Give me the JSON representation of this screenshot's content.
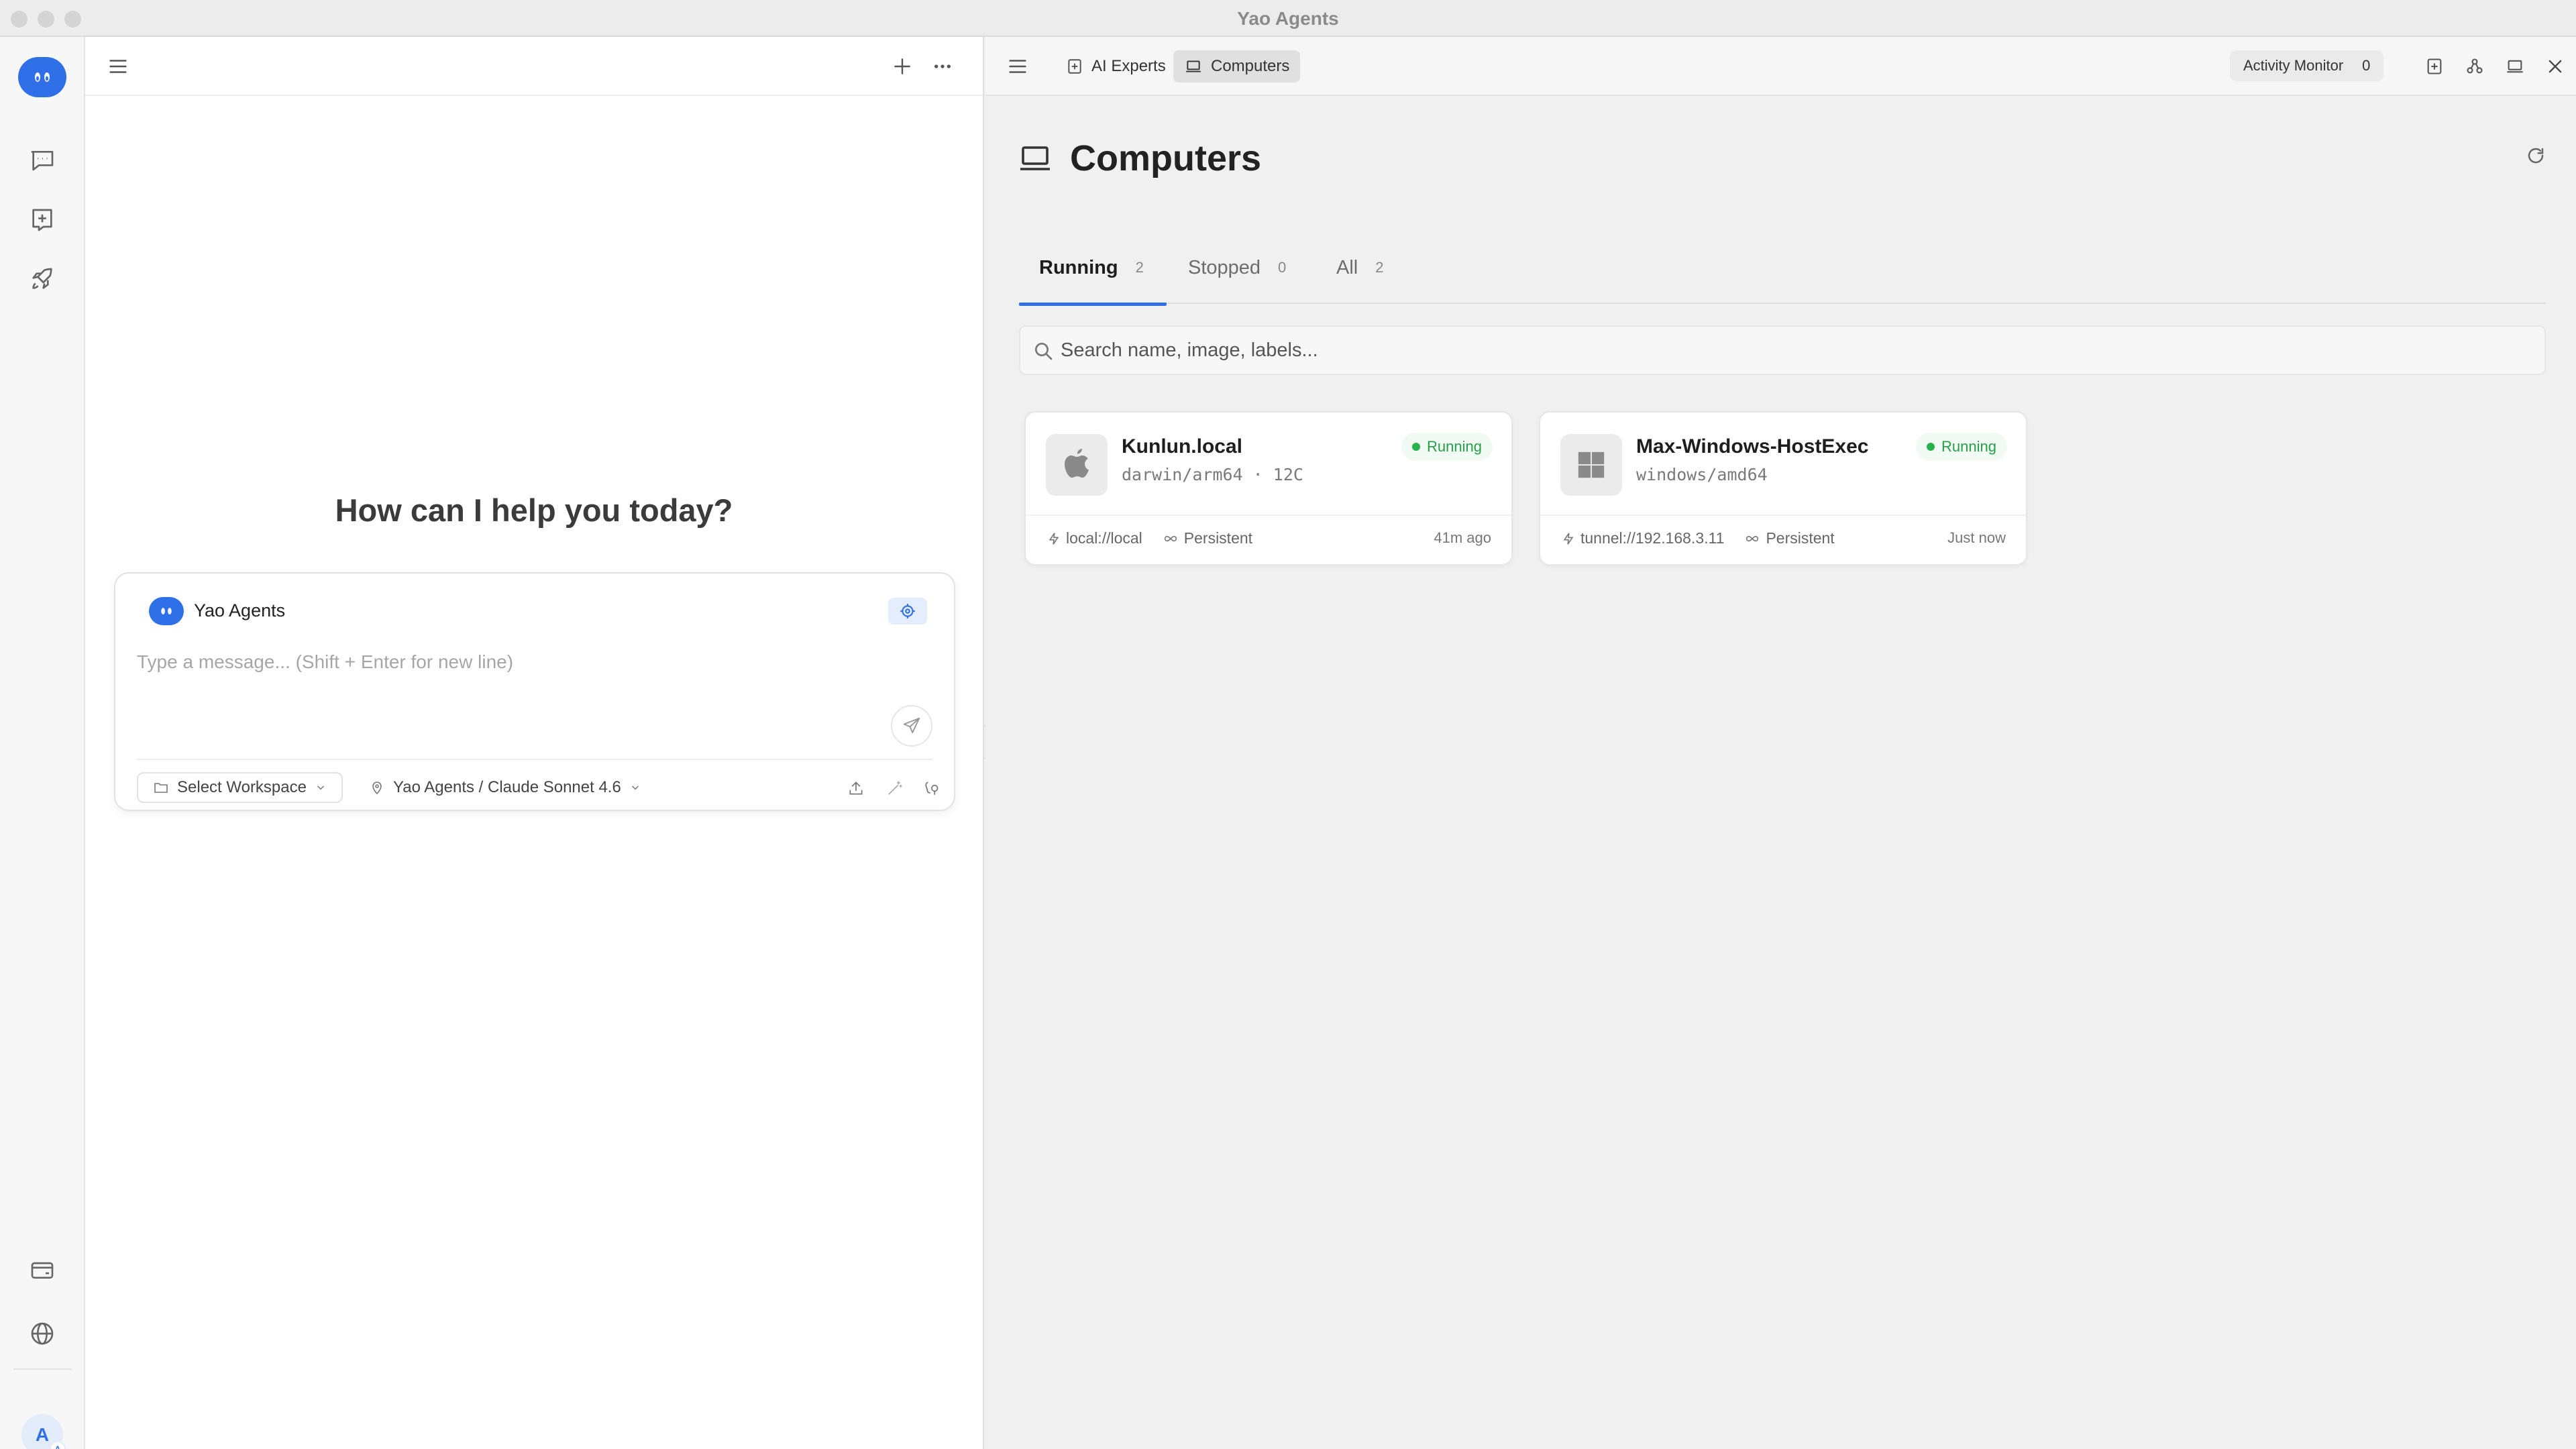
{
  "window": {
    "title": "Yao Agents"
  },
  "rail": {
    "items": [
      "chat-icon",
      "new-chat-icon",
      "rocket-icon",
      "wallet-icon",
      "globe-icon"
    ],
    "avatar_letter": "A",
    "avatar_sub": "A"
  },
  "chat": {
    "greeting": "How can I help you today?",
    "composer": {
      "agent_name": "Yao Agents",
      "placeholder": "Type a message... (Shift + Enter for new line)",
      "workspace_label": "Select Workspace",
      "model_label": "Yao Agents / Claude Sonnet 4.6"
    }
  },
  "workspace": {
    "tabs": [
      {
        "label": "AI Experts",
        "icon": "plus-square-icon"
      },
      {
        "label": "Computers",
        "icon": "laptop-icon",
        "active": true
      }
    ],
    "activity_monitor": {
      "label": "Activity Monitor",
      "count": "0"
    },
    "page_title": "Computers",
    "filter_tabs": [
      {
        "label": "Running",
        "count": "2",
        "active": true
      },
      {
        "label": "Stopped",
        "count": "0"
      },
      {
        "label": "All",
        "count": "2"
      }
    ],
    "search": {
      "placeholder": "Search name, image, labels..."
    },
    "computers": [
      {
        "name": "Kunlun.local",
        "arch": "darwin/arm64 · 12C",
        "status": "Running",
        "address": "local://local",
        "mode": "Persistent",
        "time": "41m ago",
        "os_icon": "apple-icon"
      },
      {
        "name": "Max-Windows-HostExec",
        "arch": "windows/amd64",
        "status": "Running",
        "address": "tunnel://192.168.3.11",
        "mode": "Persistent",
        "time": "Just now",
        "os_icon": "windows-icon"
      }
    ]
  },
  "colors": {
    "accent": "#2f6fe8",
    "running": "#24a148",
    "running_bg": "#f1faf3"
  }
}
